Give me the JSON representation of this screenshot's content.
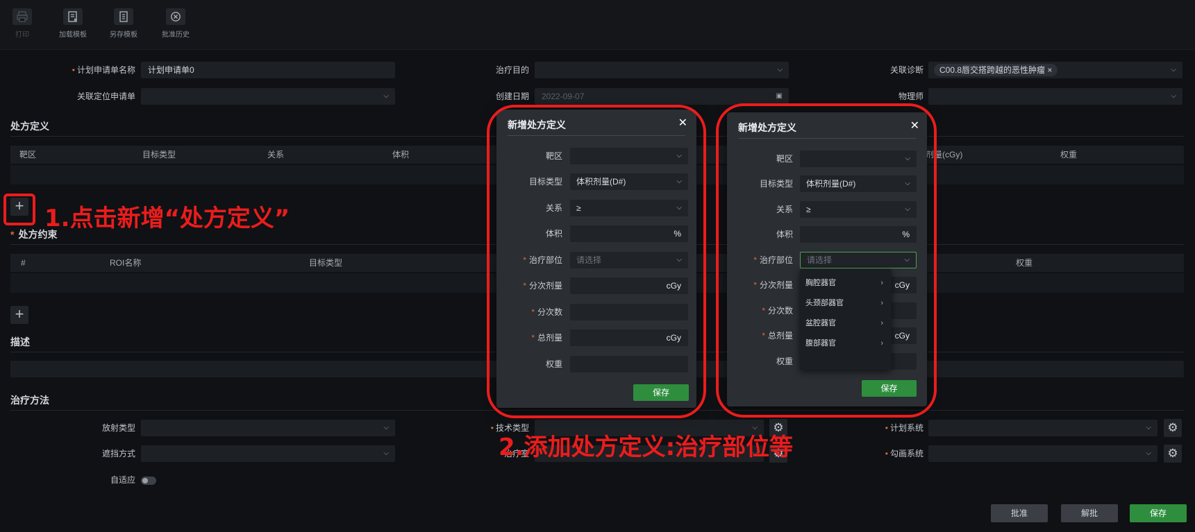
{
  "toolbar": {
    "print_label": "打印",
    "load_template_label": "加载模板",
    "save_as_template_label": "另存模板",
    "approval_history_label": "批准历史"
  },
  "form": {
    "plan_name_label": "计划申请单名称",
    "plan_name_value": "计划申请单0",
    "treatment_goal_label": "治疗目的",
    "related_diagnosis_label": "关联诊断",
    "related_diagnosis_tag": "C00.8唇交搭跨越的恶性肿瘤",
    "related_diagnosis_tag_remove": "×",
    "related_location_label": "关联定位申请单",
    "created_date_label": "创建日期",
    "created_date_value": "2022-09-07",
    "physicist_label": "物理师"
  },
  "prescription_def": {
    "title": "处方定义",
    "columns": [
      "靶区",
      "目标类型",
      "关系",
      "体积",
      "剂量(cGy)",
      "权重"
    ],
    "add_label": "+"
  },
  "prescription_constraint": {
    "title": "处方约束",
    "columns": [
      "#",
      "ROI名称",
      "目标类型",
      "权重"
    ],
    "add_label": "+"
  },
  "description": {
    "title": "描述"
  },
  "treatment_method": {
    "title": "治疗方法",
    "radiation_type_label": "放射类型",
    "technique_type_label": "技术类型",
    "planning_system_label": "计划系统",
    "blocking_label": "遮挡方式",
    "treatment_room_label": "治疗室",
    "contouring_system_label": "勾画系统",
    "adaptive_label": "自适应"
  },
  "footer": {
    "approve_label": "批准",
    "unapprove_label": "解批",
    "save_label": "保存"
  },
  "dialog_left": {
    "title": "新增处方定义",
    "close": "✕",
    "fields": {
      "target_label": "靶区",
      "target_value": "",
      "goal_type_label": "目标类型",
      "goal_type_value": "体积剂量(D#)",
      "relation_label": "关系",
      "relation_value": "≥",
      "volume_label": "体积",
      "volume_unit": "%",
      "site_label": "治疗部位",
      "site_placeholder": "请选择",
      "fraction_dose_label": "分次剂量",
      "fraction_dose_unit": "cGy",
      "fractions_label": "分次数",
      "total_dose_label": "总剂量",
      "total_dose_unit": "cGy",
      "weight_label": "权重"
    },
    "save_label": "保存"
  },
  "dialog_right": {
    "title": "新增处方定义",
    "close": "✕",
    "fields": {
      "target_label": "靶区",
      "goal_type_label": "目标类型",
      "goal_type_value": "体积剂量(D#)",
      "relation_label": "关系",
      "relation_value": "≥",
      "volume_label": "体积",
      "volume_unit": "%",
      "site_label": "治疗部位",
      "site_placeholder": "请选择",
      "fraction_dose_label": "分次剂量",
      "fraction_dose_unit": "cGy",
      "fractions_label": "分次数",
      "total_dose_label": "总剂量",
      "total_dose_unit": "cGy",
      "weight_label": "权重"
    },
    "dropdown_options": [
      "胸腔器官",
      "头颈部器官",
      "盆腔器官",
      "腹部器官"
    ],
    "save_label": "保存"
  },
  "annotations": {
    "step1": "1.点击新增“处方定义”",
    "step2": "2.添加处方定义:治疗部位等"
  },
  "colors": {
    "annotation_red": "#ec1c1c",
    "save_green": "#2e8e3e",
    "required_orange": "#e0683a",
    "background": "#0f1114"
  },
  "icons": [
    "printer-icon",
    "load-template-icon",
    "save-template-icon",
    "history-icon",
    "chevron-down-icon",
    "calendar-icon",
    "close-icon",
    "gear-icon",
    "plus-icon",
    "chevron-right-icon"
  ]
}
